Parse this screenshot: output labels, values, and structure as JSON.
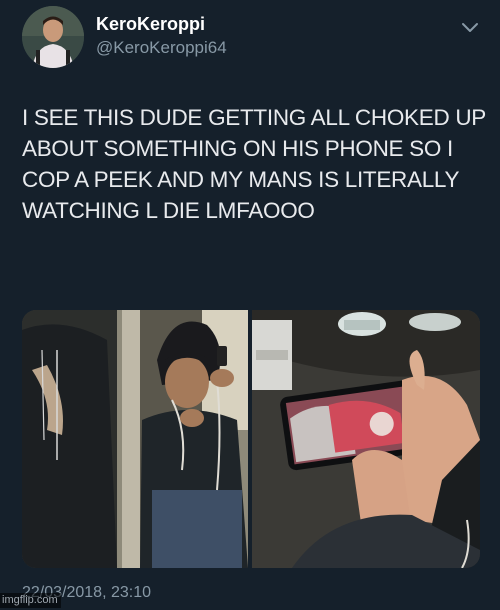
{
  "author": {
    "display_name": "KeroKeroppi",
    "handle": "@KeroKeroppi64"
  },
  "tweet": {
    "text": "I SEE THIS DUDE GETTING ALL CHOKED UP ABOUT SOMETHING ON HIS PHONE SO I COP A PEEK AND MY MANS IS LITERALLY WATCHING L DIE LMFAOOO",
    "timestamp": "22/03/2018, 23:10"
  },
  "menu": {
    "icon": "chevron-down-icon"
  },
  "media": {
    "photo_count": 2,
    "photo_1": "subway-passenger-photo",
    "photo_2": "phone-screen-photo"
  },
  "watermark": "imgflip.com",
  "colors": {
    "background": "#15202b",
    "text_primary": "#ffffff",
    "text_secondary": "#8899a6"
  }
}
